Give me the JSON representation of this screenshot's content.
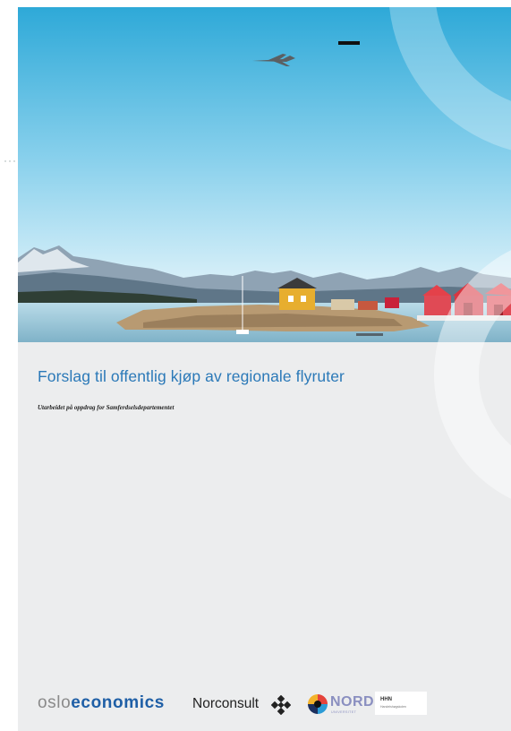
{
  "document": {
    "title": "Forslag til offentlig kjøp av regionale flyruter",
    "subtitle": "Utarbeidet på oppdrag for Samferdselsdepartementet"
  },
  "cover_image": {
    "icon": "coastal-village-photo"
  },
  "logos": {
    "oslo_part1": "oslo",
    "oslo_part2": "economics",
    "norconsult": "Norconsult",
    "nord": "NORD",
    "nord_sub": "UNIVERSITET",
    "hhn": "HHN",
    "hhn_sub": "Handelshøgskolen"
  },
  "colors": {
    "title": "#2b79b8",
    "page_background": "#ecedee",
    "oslo_economics_blue": "#1f5fa6"
  }
}
